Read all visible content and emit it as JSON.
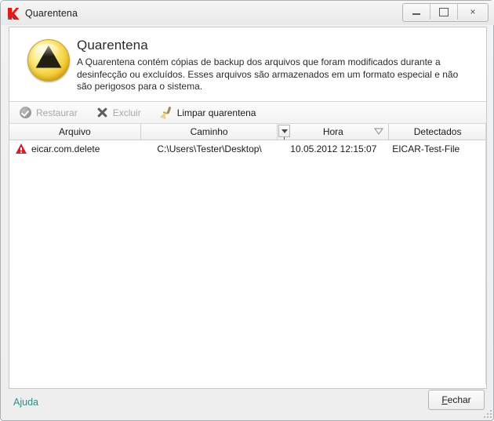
{
  "window": {
    "title": "Quarentena",
    "logo_icon": "kaspersky-k-icon",
    "controls": {
      "minimize": "minimize-icon",
      "maximize": "maximize-icon",
      "close": "×"
    }
  },
  "header": {
    "icon": "radiation-hazard-icon",
    "title": "Quarentena",
    "description": "A Quarentena contém cópias de backup dos arquivos que foram modificados durante a desinfecção ou excluídos. Esses arquivos são armazenados em um formato especial e não são perigosos para o sistema."
  },
  "toolbar": {
    "restore_label": "Restaurar",
    "restore_icon": "check-circle-icon",
    "restore_enabled": false,
    "delete_label": "Excluir",
    "delete_icon": "cross-icon",
    "delete_enabled": false,
    "clear_label": "Limpar quarentena",
    "clear_icon": "broom-icon",
    "clear_enabled": true
  },
  "table": {
    "columns": [
      {
        "key": "arquivo",
        "label": "Arquivo"
      },
      {
        "key": "caminho",
        "label": "Caminho"
      },
      {
        "key": "hora",
        "label": "Hora",
        "filter_icon": "filter-funnel-icon",
        "sort_icon": "sort-descending-icon"
      },
      {
        "key": "detectados",
        "label": "Detectados"
      }
    ],
    "rows": [
      {
        "status_icon": "warning-triangle-icon",
        "arquivo": "eicar.com.delete",
        "caminho": "C:\\Users\\Tester\\Desktop\\",
        "hora": "10.05.2012 12:15:07",
        "detectados": "EICAR-Test-File"
      }
    ]
  },
  "footer": {
    "help_label": "Ajuda",
    "close_accel": "F",
    "close_rest": "echar"
  },
  "colors": {
    "accent_link": "#2e8b87",
    "hazard_yellow": "#f5cf3a",
    "warning_red": "#d91f26",
    "brand_red": "#e01a1a"
  }
}
